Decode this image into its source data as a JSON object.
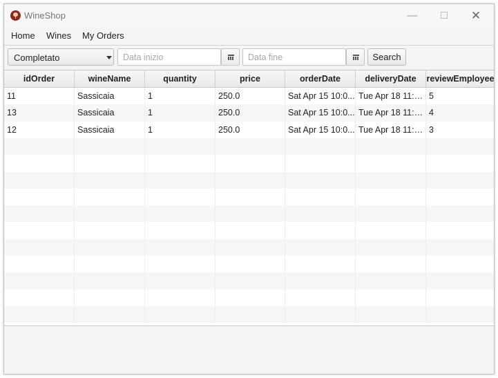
{
  "window": {
    "title": "WineShop"
  },
  "menu": {
    "items": [
      "Home",
      "Wines",
      "My Orders"
    ]
  },
  "filters": {
    "status_value": "Completato",
    "start_placeholder": "Data inizio",
    "end_placeholder": "Data fine",
    "search_label": "Search"
  },
  "table": {
    "columns": [
      "idOrder",
      "wineName",
      "quantity",
      "price",
      "orderDate",
      "deliveryDate",
      "reviewEmployee"
    ],
    "rows": [
      [
        "11",
        "Sassicaia",
        "1",
        "250.0",
        "Sat Apr 15 10:0...",
        "Tue Apr 18 11:3...",
        "5"
      ],
      [
        "13",
        "Sassicaia",
        "1",
        "250.0",
        "Sat Apr 15 10:0...",
        "Tue Apr 18 11:3...",
        "4"
      ],
      [
        "12",
        "Sassicaia",
        "1",
        "250.0",
        "Sat Apr 15 10:0...",
        "Tue Apr 18 11:3...",
        "3"
      ]
    ]
  },
  "colors": {
    "app_icon": "#8a2a17",
    "row_alt": "#f6f6f6",
    "window_bg": "#f4f4f4"
  }
}
